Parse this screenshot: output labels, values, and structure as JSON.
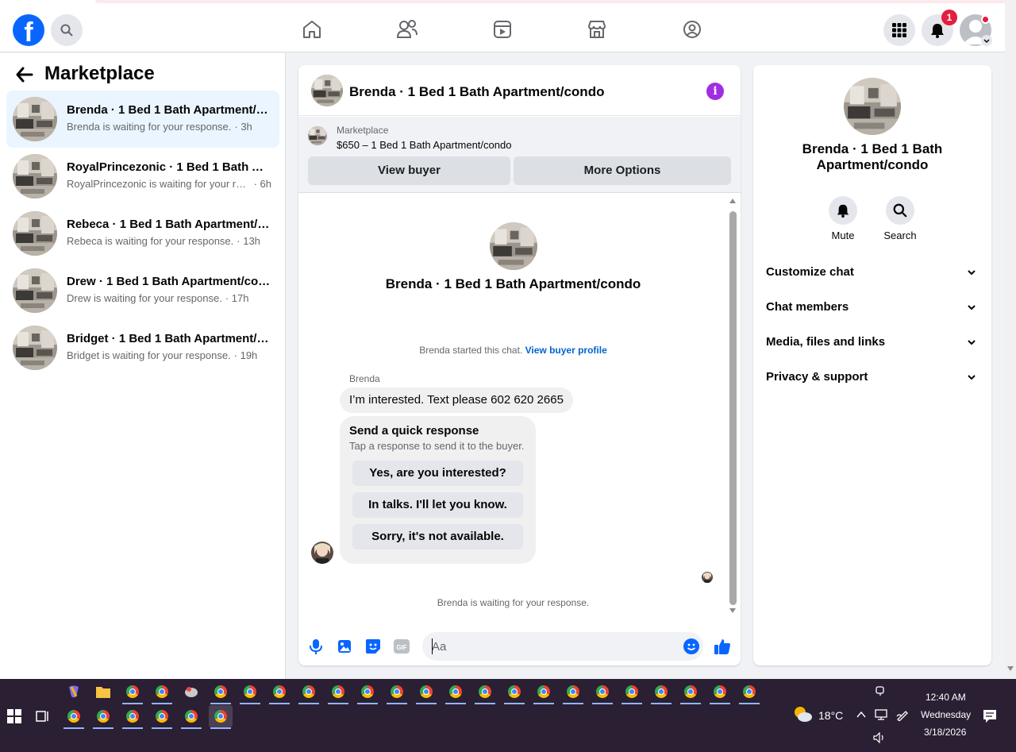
{
  "nav": {
    "notification_count": "1"
  },
  "sidebar": {
    "title": "Marketplace",
    "conversations": [
      {
        "title": "Brenda · 1 Bed 1 Bath Apartment/condo",
        "preview": "Brenda is waiting for your response.",
        "time": "· 3h",
        "active": true
      },
      {
        "title": "RoyalPrincezonic · 1 Bed 1 Bath Apartment/condo",
        "preview": "RoyalPrincezonic is waiting for your response.",
        "time": "· 6h",
        "active": false
      },
      {
        "title": "Rebeca · 1 Bed 1 Bath Apartment/condo",
        "preview": "Rebeca is waiting for your response.",
        "time": "· 13h",
        "active": false
      },
      {
        "title": "Drew · 1 Bed 1 Bath Apartment/condo",
        "preview": "Drew is waiting for your response.",
        "time": "· 17h",
        "active": false
      },
      {
        "title": "Bridget · 1 Bed 1 Bath Apartment/condo",
        "preview": "Bridget is waiting for your response.",
        "time": "· 19h",
        "active": false
      }
    ]
  },
  "chat": {
    "header_title": "Brenda · 1 Bed 1 Bath Apartment/condo",
    "marketplace_label": "Marketplace",
    "listing": "$650 – 1 Bed 1 Bath Apartment/condo",
    "view_buyer": "View buyer",
    "more_options": "More Options",
    "big_title": "Brenda · 1 Bed 1 Bath Apartment/condo",
    "started_text": "Brenda started this chat.",
    "view_buyer_profile": "View buyer profile",
    "sender": "Brenda",
    "message": "I’m interested. Text please 602 620 2665",
    "quick_heading": "Send a quick response",
    "quick_sub": "Tap a response to send it to the buyer.",
    "quick_replies": [
      "Yes, are you interested?",
      "In talks. I'll let you know.",
      "Sorry, it's not available."
    ],
    "waiting": "Brenda is waiting for your response.",
    "input_placeholder": "Aa"
  },
  "info": {
    "name": "Brenda · 1 Bed 1 Bath Apartment/condo",
    "mute": "Mute",
    "search": "Search",
    "sections": [
      "Customize chat",
      "Chat members",
      "Media, files and links",
      "Privacy & support"
    ]
  },
  "taskbar": {
    "temperature": "18°C",
    "time": "12:40 AM",
    "day": "Wednesday",
    "date": "3/18/2026"
  },
  "colors": {
    "brand_blue": "#0866ff",
    "active_conv_bg": "#ebf5ff",
    "info_purple": "#a12de3",
    "link_blue": "#0064d1",
    "taskbar_bg": "#2b1f33"
  }
}
